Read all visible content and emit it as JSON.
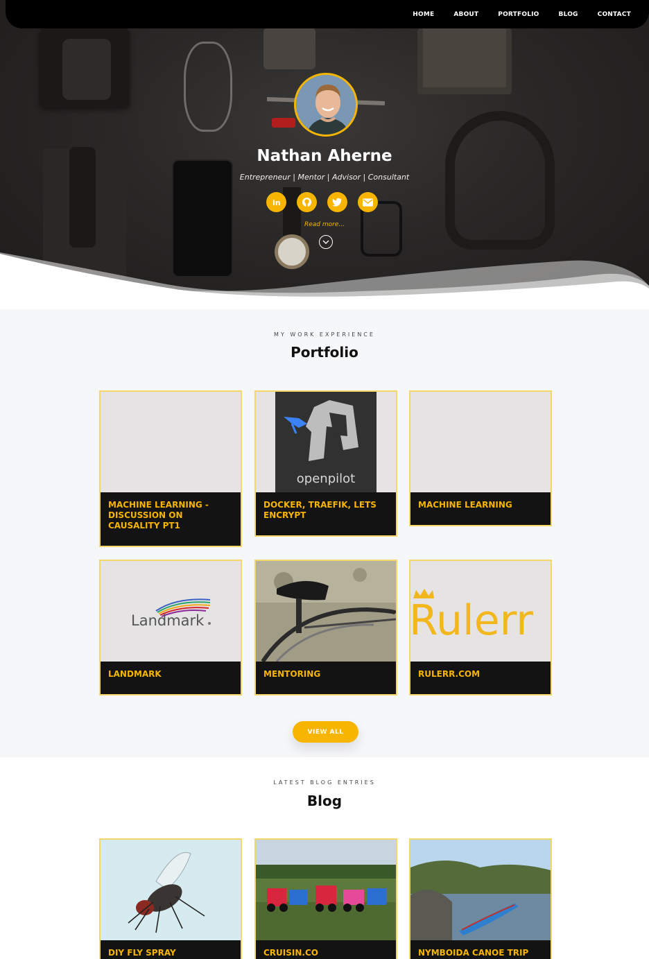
{
  "nav": {
    "items": [
      "HOME",
      "ABOUT",
      "PORTFOLIO",
      "BLOG",
      "CONTACT"
    ]
  },
  "hero": {
    "name": "Nathan Aherne",
    "tagline": "Entrepreneur | Mentor | Advisor | Consultant",
    "read_more": "Read more...",
    "socials": [
      "linkedin-icon",
      "github-icon",
      "twitter-icon",
      "email-icon"
    ]
  },
  "portfolio": {
    "kicker": "MY WORK EXPERIENCE",
    "title": "Portfolio",
    "items": [
      {
        "title": "MACHINE LEARNING - DISCUSSION ON CAUSALITY PT1"
      },
      {
        "title": "DOCKER, TRAEFIK, LETS ENCRYPT",
        "logo_text": "openpilot"
      },
      {
        "title": "MACHINE LEARNING"
      },
      {
        "title": "LANDMARK",
        "logo_text": "Landmark"
      },
      {
        "title": "MENTORING"
      },
      {
        "title": "RULERR.COM",
        "logo_text": "Rulerr"
      }
    ],
    "view_all": "VIEW ALL"
  },
  "blog": {
    "kicker": "LATEST BLOG ENTRIES",
    "title": "Blog",
    "items": [
      {
        "title": "DIY FLY SPRAY"
      },
      {
        "title": "CRUISIN.CO"
      },
      {
        "title": "NYMBOIDA CANOE TRIP"
      }
    ]
  },
  "colors": {
    "accent": "#f7b500",
    "card_bg": "#131313",
    "card_border": "#f5d66b"
  }
}
